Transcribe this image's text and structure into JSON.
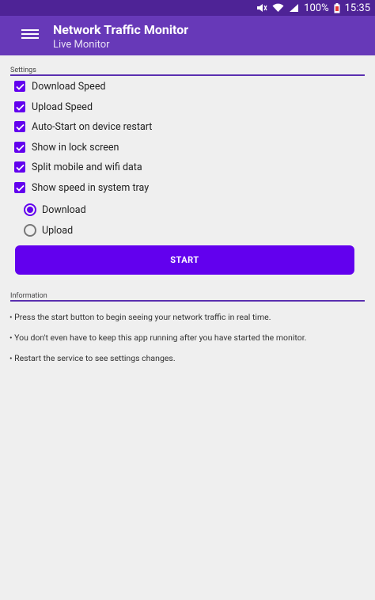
{
  "status_bar": {
    "battery": "100%",
    "time": "15:35"
  },
  "app_bar": {
    "title": "Network Traffic Monitor",
    "subtitle": "Live Monitor"
  },
  "settings": {
    "label": "Settings",
    "checkboxes": [
      {
        "label": "Download Speed",
        "checked": true
      },
      {
        "label": "Upload Speed",
        "checked": true
      },
      {
        "label": "Auto-Start on device restart",
        "checked": true
      },
      {
        "label": "Show in lock screen",
        "checked": true
      },
      {
        "label": "Split mobile and wifi data",
        "checked": true
      },
      {
        "label": "Show speed in system tray",
        "checked": true
      }
    ],
    "radios": [
      {
        "label": "Download",
        "selected": true
      },
      {
        "label": "Upload",
        "selected": false
      }
    ],
    "start_label": "START"
  },
  "information": {
    "label": "Information",
    "lines": [
      "• Press the start button to begin seeing your network traffic in real time.",
      "• You don't even have to keep this app running after you have started the monitor.",
      "• Restart the service to see settings changes."
    ]
  }
}
